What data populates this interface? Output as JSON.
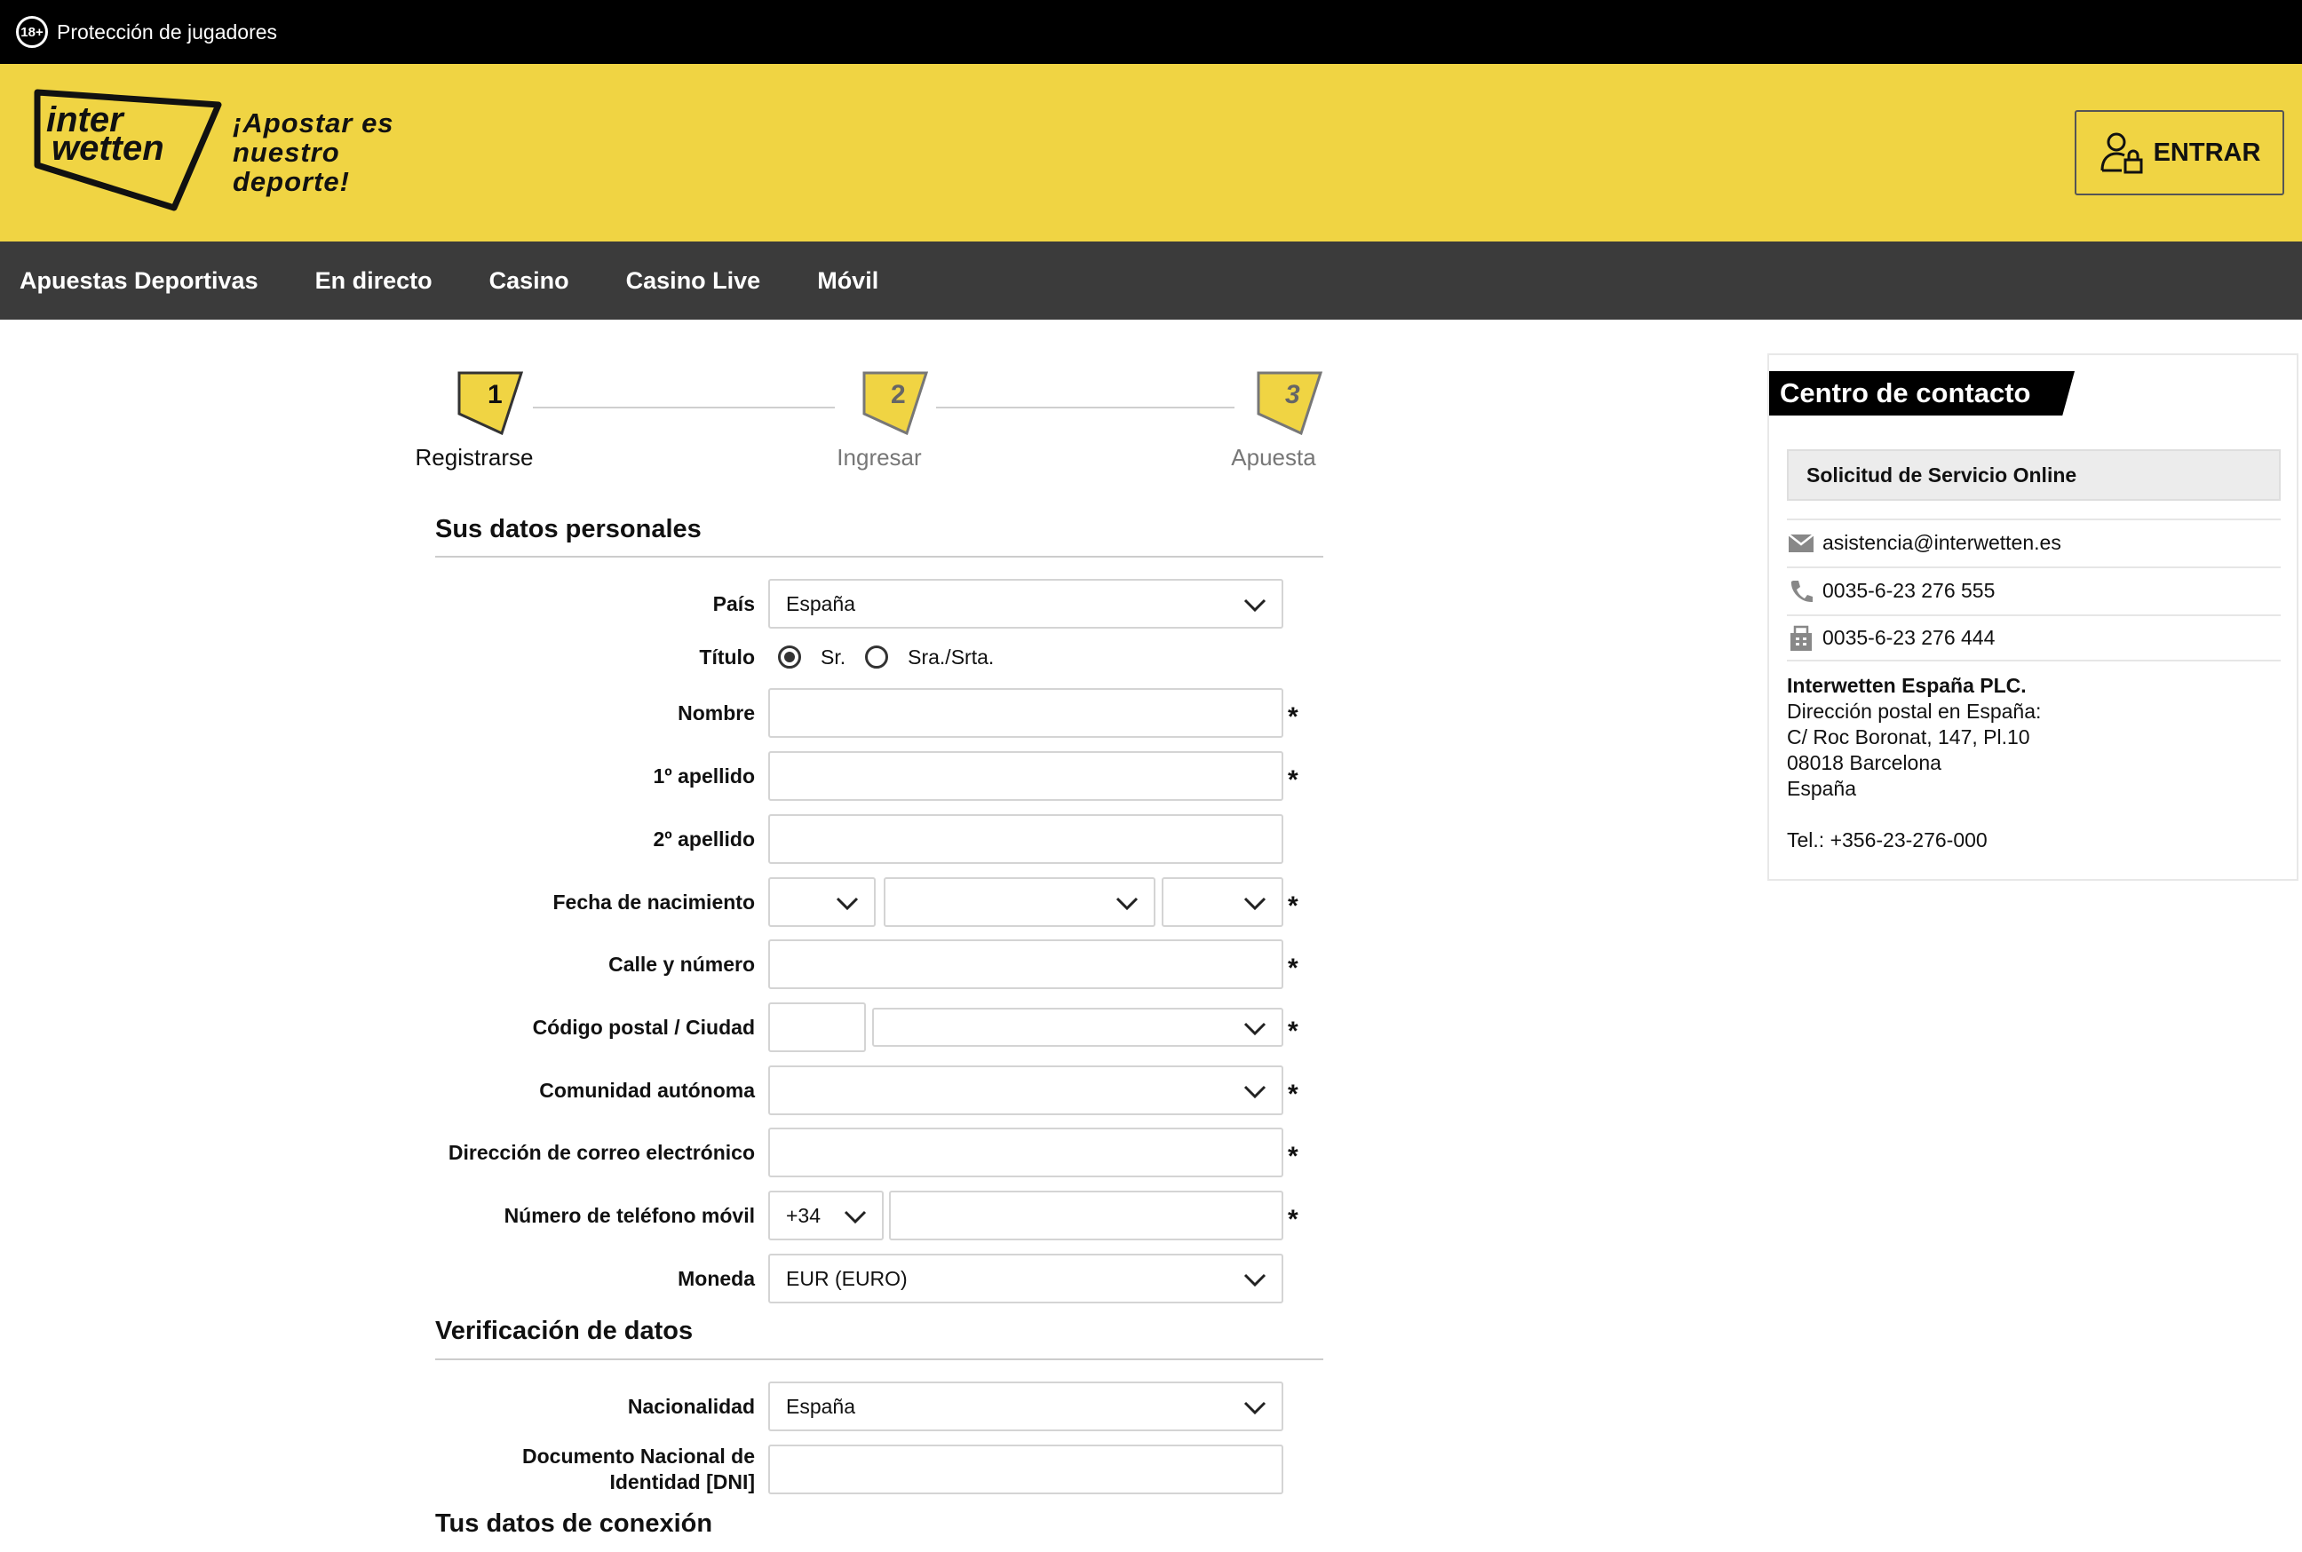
{
  "topbar": {
    "age_badge": "18+",
    "player_protection": "Protección de jugadores"
  },
  "header": {
    "logo_line1": "inter",
    "logo_line2": "wetten",
    "tagline_line1": "¡Apostar es",
    "tagline_line2": "nuestro",
    "tagline_line3": "deporte!",
    "login_label": "ENTRAR"
  },
  "nav": {
    "items": [
      "Apuestas Deportivas",
      "En directo",
      "Casino",
      "Casino Live",
      "Móvil"
    ]
  },
  "stepper": {
    "steps": [
      {
        "number": "1",
        "label": "Registrarse",
        "active": true
      },
      {
        "number": "2",
        "label": "Ingresar",
        "active": false
      },
      {
        "number": "3",
        "label": "Apuesta",
        "active": false
      }
    ]
  },
  "form": {
    "personal_title": "Sus datos personales",
    "country_label": "País",
    "country_value": "España",
    "title_label": "Título",
    "title_options": [
      "Sr.",
      "Sra./Srta."
    ],
    "first_name_label": "Nombre",
    "surname1_label": "1º apellido",
    "surname2_label": "2º apellido",
    "birth_label": "Fecha de nacimiento",
    "street_label": "Calle y número",
    "postal_label": "Código postal / Ciudad",
    "region_label": "Comunidad autónoma",
    "email_label": "Dirección de correo electrónico",
    "phone_label": "Número de teléfono móvil",
    "phone_prefix": "+34",
    "currency_label": "Moneda",
    "currency_value": "EUR (EURO)",
    "required_mark": "*",
    "verification_title": "Verificación de datos",
    "nationality_label": "Nacionalidad",
    "nationality_value": "España",
    "dni_label_line1": "Documento Nacional de",
    "dni_label_line2": "Identidad [DNI]",
    "connection_title": "Tus datos de conexión"
  },
  "contact": {
    "title": "Centro de contacto",
    "service_request": "Solicitud de Servicio Online",
    "email": "asistencia@interwetten.es",
    "phone": "0035-6-23 276 555",
    "fax": "0035-6-23 276 444",
    "company": "Interwetten España PLC.",
    "address_line1": "Dirección postal en España:",
    "address_line2": "C/ Roc Boronat, 147, Pl.10",
    "address_line3": "08018 Barcelona",
    "address_line4": "España",
    "tel": "Tel.: +356-23-276-000"
  },
  "colors": {
    "brand_yellow": "#f0d443",
    "nav_grey": "#3b3b3b",
    "black": "#000000"
  }
}
